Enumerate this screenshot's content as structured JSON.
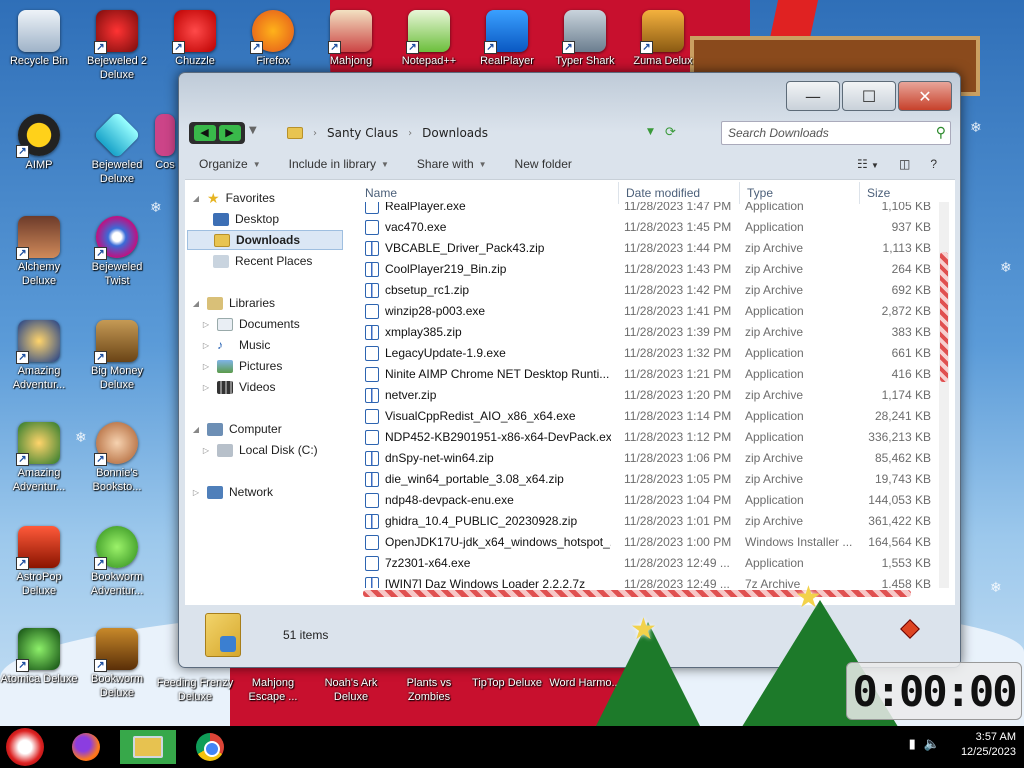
{
  "desktop": {
    "icons": [
      {
        "label": "Recycle Bin"
      },
      {
        "label": "Bejeweled 2 Deluxe"
      },
      {
        "label": "Chuzzle"
      },
      {
        "label": "Firefox"
      },
      {
        "label": "Mahjong"
      },
      {
        "label": "Notepad++"
      },
      {
        "label": "RealPlayer"
      },
      {
        "label": "Typer Shark"
      },
      {
        "label": "Zuma Delux"
      },
      {
        "label": "AIMP"
      },
      {
        "label": "Bejeweled Deluxe"
      },
      {
        "label": "Cos"
      },
      {
        "label": "Alchemy Deluxe"
      },
      {
        "label": "Bejeweled Twist"
      },
      {
        "label": "Amazing Adventur..."
      },
      {
        "label": "Big Money Deluxe"
      },
      {
        "label": "Amazing Adventur..."
      },
      {
        "label": "Bonnie's Booksto..."
      },
      {
        "label": "AstroPop Deluxe"
      },
      {
        "label": "Bookworm Adventur..."
      },
      {
        "label": "Atomica Deluxe"
      },
      {
        "label": "Bookworm Deluxe"
      },
      {
        "label": "Feeding Frenzy Deluxe"
      },
      {
        "label": "Mahjong Escape ..."
      },
      {
        "label": "Noah's Ark Deluxe"
      },
      {
        "label": "Plants vs Zombies"
      },
      {
        "label": "TipTop Deluxe"
      },
      {
        "label": "Word Harmo..."
      }
    ]
  },
  "window": {
    "caption": {
      "minimize": "—",
      "maximize": "☐",
      "close": "✕"
    },
    "breadcrumb": [
      "Santy Claus",
      "Downloads"
    ],
    "search_placeholder": "Search Downloads",
    "toolbar": {
      "organize": "Organize",
      "include": "Include in library",
      "share": "Share with",
      "new_folder": "New folder"
    },
    "nav": {
      "favorites": "Favorites",
      "desktop": "Desktop",
      "downloads": "Downloads",
      "recent": "Recent Places",
      "libraries": "Libraries",
      "documents": "Documents",
      "music": "Music",
      "pictures": "Pictures",
      "videos": "Videos",
      "computer": "Computer",
      "localdisk": "Local Disk (C:)",
      "network": "Network"
    },
    "columns": {
      "name": "Name",
      "date": "Date modified",
      "type": "Type",
      "size": "Size"
    },
    "files": [
      {
        "name": "RealPlayer.exe",
        "date": "11/28/2023 1:47 PM",
        "type": "Application",
        "size": "1,105 KB",
        "kind": "exe"
      },
      {
        "name": "vac470.exe",
        "date": "11/28/2023 1:45 PM",
        "type": "Application",
        "size": "937 KB",
        "kind": "exe"
      },
      {
        "name": "VBCABLE_Driver_Pack43.zip",
        "date": "11/28/2023 1:44 PM",
        "type": "zip Archive",
        "size": "1,113 KB",
        "kind": "zip"
      },
      {
        "name": "CoolPlayer219_Bin.zip",
        "date": "11/28/2023 1:43 PM",
        "type": "zip Archive",
        "size": "264 KB",
        "kind": "zip"
      },
      {
        "name": "cbsetup_rc1.zip",
        "date": "11/28/2023 1:42 PM",
        "type": "zip Archive",
        "size": "692 KB",
        "kind": "zip"
      },
      {
        "name": "winzip28-p003.exe",
        "date": "11/28/2023 1:41 PM",
        "type": "Application",
        "size": "2,872 KB",
        "kind": "exe"
      },
      {
        "name": "xmplay385.zip",
        "date": "11/28/2023 1:39 PM",
        "type": "zip Archive",
        "size": "383 KB",
        "kind": "zip"
      },
      {
        "name": "LegacyUpdate-1.9.exe",
        "date": "11/28/2023 1:32 PM",
        "type": "Application",
        "size": "661 KB",
        "kind": "exe"
      },
      {
        "name": "Ninite AIMP Chrome NET Desktop Runti...",
        "date": "11/28/2023 1:21 PM",
        "type": "Application",
        "size": "416 KB",
        "kind": "exe"
      },
      {
        "name": "netver.zip",
        "date": "11/28/2023 1:20 PM",
        "type": "zip Archive",
        "size": "1,174 KB",
        "kind": "zip"
      },
      {
        "name": "VisualCppRedist_AIO_x86_x64.exe",
        "date": "11/28/2023 1:14 PM",
        "type": "Application",
        "size": "28,241 KB",
        "kind": "exe"
      },
      {
        "name": "NDP452-KB2901951-x86-x64-DevPack.exe",
        "date": "11/28/2023 1:12 PM",
        "type": "Application",
        "size": "336,213 KB",
        "kind": "exe"
      },
      {
        "name": "dnSpy-net-win64.zip",
        "date": "11/28/2023 1:06 PM",
        "type": "zip Archive",
        "size": "85,462 KB",
        "kind": "zip"
      },
      {
        "name": "die_win64_portable_3.08_x64.zip",
        "date": "11/28/2023 1:05 PM",
        "type": "zip Archive",
        "size": "19,743 KB",
        "kind": "zip"
      },
      {
        "name": "ndp48-devpack-enu.exe",
        "date": "11/28/2023 1:04 PM",
        "type": "Application",
        "size": "144,053 KB",
        "kind": "exe"
      },
      {
        "name": "ghidra_10.4_PUBLIC_20230928.zip",
        "date": "11/28/2023 1:01 PM",
        "type": "zip Archive",
        "size": "361,422 KB",
        "kind": "zip"
      },
      {
        "name": "OpenJDK17U-jdk_x64_windows_hotspot_...",
        "date": "11/28/2023 1:00 PM",
        "type": "Windows Installer ...",
        "size": "164,564 KB",
        "kind": "msi"
      },
      {
        "name": "7z2301-x64.exe",
        "date": "11/28/2023 12:49 ...",
        "type": "Application",
        "size": "1,553 KB",
        "kind": "exe"
      },
      {
        "name": "[WIN7] Daz Windows Loader 2.2.2.7z",
        "date": "11/28/2023 12:49 ...",
        "type": "7z Archive",
        "size": "1,458 KB",
        "kind": "zip"
      }
    ],
    "status": {
      "count": "51 items"
    }
  },
  "gadget": {
    "timer": "0:00:00"
  },
  "taskbar": {
    "time": "3:57 AM",
    "date": "12/25/2023"
  }
}
